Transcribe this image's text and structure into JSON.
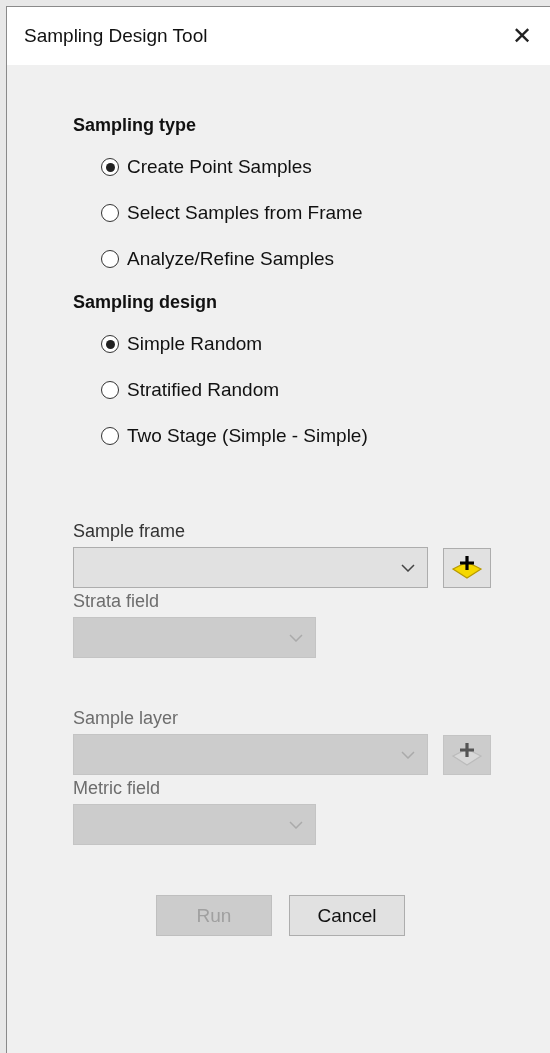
{
  "window": {
    "title": "Sampling Design Tool",
    "close": "✕"
  },
  "sections": [
    {
      "title": "Sampling type",
      "options": [
        {
          "label": "Create Point Samples",
          "selected": true
        },
        {
          "label": "Select Samples from Frame",
          "selected": false
        },
        {
          "label": "Analyze/Refine Samples",
          "selected": false
        }
      ]
    },
    {
      "title": "Sampling design",
      "options": [
        {
          "label": "Simple Random",
          "selected": true
        },
        {
          "label": "Stratified Random",
          "selected": false
        },
        {
          "label": "Two Stage (Simple - Simple)",
          "selected": false
        }
      ]
    }
  ],
  "field_groups": [
    [
      {
        "label": "Sample frame",
        "kind": "wide",
        "disabled": false,
        "add_button": {
          "disabled": false
        }
      },
      {
        "label": "Strata field",
        "kind": "narrow",
        "disabled": true
      }
    ],
    [
      {
        "label": "Sample layer",
        "kind": "wide",
        "disabled": true,
        "add_button": {
          "disabled": true
        }
      },
      {
        "label": "Metric field",
        "kind": "narrow",
        "disabled": true
      }
    ]
  ],
  "buttons": [
    {
      "label": "Run",
      "disabled": true
    },
    {
      "label": "Cancel",
      "disabled": false
    }
  ]
}
